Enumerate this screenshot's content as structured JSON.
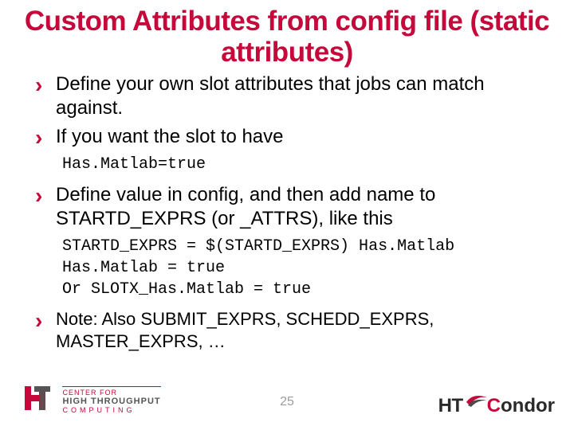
{
  "title": "Custom Attributes from config file (static attributes)",
  "bullets": {
    "b1": "Define your own slot attributes that jobs can match against.",
    "b2": "If you want the slot to have",
    "code1": "Has.Matlab=true",
    "b3": "Define value in config, and then add name to STARTD_EXPRS (or _ATTRS), like this",
    "code2_l1": "STARTD_EXPRS = $(STARTD_EXPRS) Has.Matlab",
    "code2_l2": "Has.Matlab = true",
    "code2_l3": "Or SLOTX_Has.Matlab = true",
    "b4": "Note: Also SUBMIT_EXPRS, SCHEDD_EXPRS, MASTER_EXPRS, …"
  },
  "footer": {
    "page": "25",
    "left_logo": {
      "center": "CENTER FOR",
      "htc": "HIGH THROUGHPUT",
      "comp": "COMPUTING"
    },
    "right_logo": {
      "ht": "HT",
      "c": "C",
      "ondor": "ondor"
    }
  },
  "colors": {
    "accent": "#c5093b"
  }
}
